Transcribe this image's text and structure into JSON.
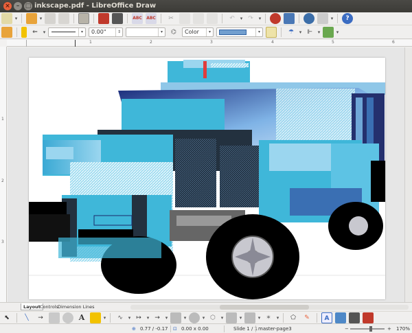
{
  "window": {
    "title": "inkscape.pdf - LibreOffice Draw"
  },
  "line_props": {
    "width_value": "0.00\"",
    "area_style": "Color"
  },
  "ruler": {
    "h_marks": [
      "1",
      "2",
      "3",
      "4",
      "5",
      "6"
    ],
    "v_marks": [
      "1",
      "2",
      "3"
    ]
  },
  "tabs": [
    "Layout",
    "Controls",
    "Dimension Lines"
  ],
  "status": {
    "position": "0.77 / -0.17",
    "size": "0.00 x 0.00",
    "slide": "Slide 1 / 1",
    "master": "master-page3",
    "zoom": "170%"
  },
  "colors": {
    "titlebar": "#3c3b37",
    "close": "#e8603a",
    "truck_primary": "#3fb7d9",
    "truck_dark": "#1b2a6b"
  }
}
